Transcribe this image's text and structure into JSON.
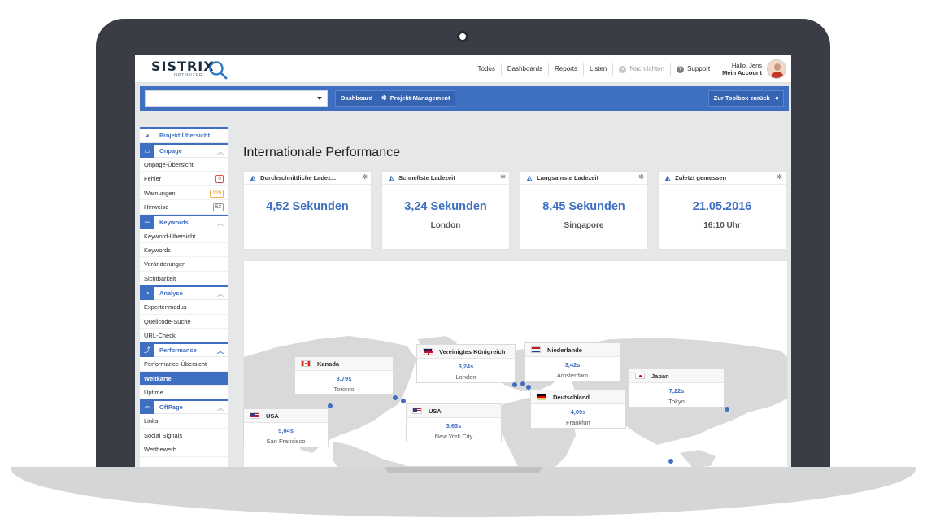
{
  "header": {
    "logo_text": "SISTRIX",
    "logo_sub": "OPTIMIZER",
    "nav": [
      "Todos",
      "Dashboards",
      "Reports",
      "Listen"
    ],
    "notifications": "Nachrichten",
    "support": "Support",
    "greeting": "Hallo, Jens",
    "account": "Mein Account"
  },
  "toolbar": {
    "project_select_value": "",
    "dashboard": "Dashboard",
    "project_management": "Projekt-Management",
    "back_to_toolbox": "Zur Toolbox zurück"
  },
  "sidebar": {
    "overview": "Projekt Übersicht",
    "onpage": {
      "title": "Onpage",
      "items": [
        "Onpage-Übersicht",
        "Fehler",
        "Warnungen",
        "Hinweise"
      ],
      "badges": [
        "0",
        "129",
        "62"
      ]
    },
    "keywords": {
      "title": "Keywords",
      "items": [
        "Keyword-Übersicht",
        "Keywords",
        "Veränderungen",
        "Sichtbarkeit"
      ]
    },
    "analyse": {
      "title": "Analyse",
      "items": [
        "Expertenmodus",
        "Quellcode-Suche",
        "URL-Check"
      ]
    },
    "performance": {
      "title": "Performance",
      "items": [
        "Performance-Übersicht",
        "Weltkarte",
        "Uptime"
      ]
    },
    "offpage": {
      "title": "OffPage",
      "items": [
        "Links",
        "Social Signals",
        "Wettbewerb"
      ]
    }
  },
  "main": {
    "title": "Internationale Performance",
    "cards": [
      {
        "title": "Durchschnittliche Ladez...",
        "value": "4,52 Sekunden",
        "sub": ""
      },
      {
        "title": "Schnellste Ladezeit",
        "value": "3,24 Sekunden",
        "sub": "London"
      },
      {
        "title": "Langsamste Ladezeit",
        "value": "8,45 Sekunden",
        "sub": "Singapore"
      },
      {
        "title": "Zuletzt gemessen",
        "value": "21.05.2016",
        "sub": "16:10 Uhr"
      }
    ],
    "map_tooltips": [
      {
        "country": "Kanada",
        "value": "3,79s",
        "city": "Toronto",
        "flag": "ca"
      },
      {
        "country": "Vereinigtes Königreich",
        "value": "3,24s",
        "city": "London",
        "flag": "uk"
      },
      {
        "country": "Niederlande",
        "value": "3,42s",
        "city": "Amsterdam",
        "flag": "nl"
      },
      {
        "country": "Japan",
        "value": "7,22s",
        "city": "Tokyo",
        "flag": "jp"
      },
      {
        "country": "Deutschland",
        "value": "4,09s",
        "city": "Frankfurt",
        "flag": "de"
      },
      {
        "country": "USA",
        "value": "3,63s",
        "city": "New York City",
        "flag": "us"
      },
      {
        "country": "USA",
        "value": "5,04s",
        "city": "San Francisco",
        "flag": "us"
      }
    ]
  },
  "colors": {
    "accent": "#3e6fc0",
    "frame": "#3a3d45",
    "background": "#e6e7e8",
    "map_land": "#d9d9d9"
  }
}
